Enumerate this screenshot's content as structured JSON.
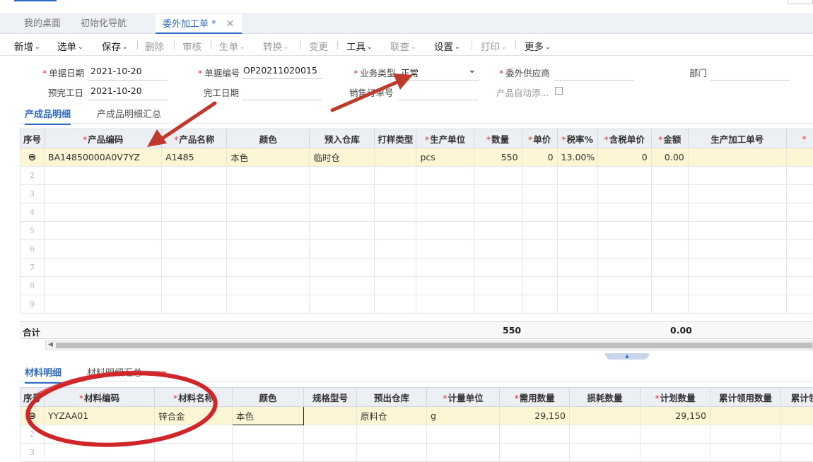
{
  "tabs": [
    {
      "label": "我的桌面",
      "active": false
    },
    {
      "label": "初始化导航",
      "active": false
    },
    {
      "label": "委外加工单",
      "active": true,
      "modified_marker": "*"
    }
  ],
  "tab_close_glyph": "✕",
  "toolbar": [
    {
      "label": "新增",
      "caret": true,
      "disabled": false
    },
    {
      "label": "选单",
      "caret": true,
      "disabled": false
    },
    {
      "label": "保存",
      "caret": true,
      "disabled": false
    },
    {
      "label": "删除",
      "caret": false,
      "disabled": true
    },
    {
      "label": "审核",
      "caret": false,
      "disabled": true
    },
    {
      "label": "生单",
      "caret": true,
      "disabled": true
    },
    {
      "label": "转换",
      "caret": true,
      "disabled": true
    },
    {
      "label": "变更",
      "caret": false,
      "disabled": true
    },
    {
      "label": "工具",
      "caret": true,
      "disabled": false
    },
    {
      "label": "联查",
      "caret": true,
      "disabled": true
    },
    {
      "label": "设置",
      "caret": true,
      "disabled": false
    },
    {
      "label": "打印",
      "caret": true,
      "disabled": true
    },
    {
      "label": "更多",
      "caret": true,
      "disabled": false
    }
  ],
  "caret_glyph": "⌄",
  "form": {
    "doc_date": {
      "label": "单据日期",
      "value": "2021-10-20"
    },
    "doc_no": {
      "label": "单据编号",
      "value": "OP20211020015"
    },
    "biz_type": {
      "label": "业务类型",
      "value": "正常"
    },
    "supplier": {
      "label": "委外供应商",
      "value": ""
    },
    "dept": {
      "label": "部门",
      "value": ""
    },
    "plan_finish": {
      "label": "预完工日",
      "value": "2021-10-20"
    },
    "finish_date": {
      "label": "完工日期",
      "value": ""
    },
    "sales_order": {
      "label": "销售订单号",
      "value": ""
    },
    "auto_add": {
      "label": "产品自动添...",
      "checked": false
    }
  },
  "product_section": {
    "tabs": [
      "产成品明细",
      "产成品明细汇总"
    ],
    "columns": [
      "序号",
      "产品编码",
      "产品名称",
      "颜色",
      "预入仓库",
      "打样类型",
      "生产单位",
      "数量",
      "单价",
      "税率%",
      "含税单价",
      "金额",
      "生产加工单号"
    ],
    "rows": [
      {
        "code": "BA14850000A0V7YZ",
        "name": "A1485",
        "color": "本色",
        "warehouse": "临时仓",
        "sample_type": "",
        "unit": "pcs",
        "qty": "550",
        "price": "0",
        "tax_rate": "13.00%",
        "tax_price": "0",
        "amount": "0.00",
        "order_no": ""
      }
    ],
    "row_numbers": [
      "2",
      "3",
      "4",
      "5",
      "6",
      "7",
      "8",
      "9"
    ],
    "total_label": "合计",
    "total_qty": "550",
    "total_amount": "0.00"
  },
  "material_section": {
    "tabs": [
      "材料明细",
      "材料明细汇总"
    ],
    "columns": [
      "序号",
      "材料编码",
      "材料名称",
      "颜色",
      "规格型号",
      "预出仓库",
      "计量单位",
      "需用数量",
      "损耗数量",
      "计划数量",
      "累计领用数量",
      "累计领"
    ],
    "rows": [
      {
        "code": "YYZAA01",
        "name": "锌合金",
        "color": "本色",
        "spec": "",
        "warehouse": "原料仓",
        "unit": "g",
        "need_qty": "29,150",
        "loss_qty": "",
        "plan_qty": "29,150",
        "issued_qty": "",
        "issued2": ""
      }
    ],
    "row_numbers": [
      "2",
      "3"
    ]
  },
  "colors": {
    "accent": "#2e6bc6",
    "required": "#e0372f",
    "selected_row": "#fdf6d4",
    "annotation": "#c0392b"
  }
}
